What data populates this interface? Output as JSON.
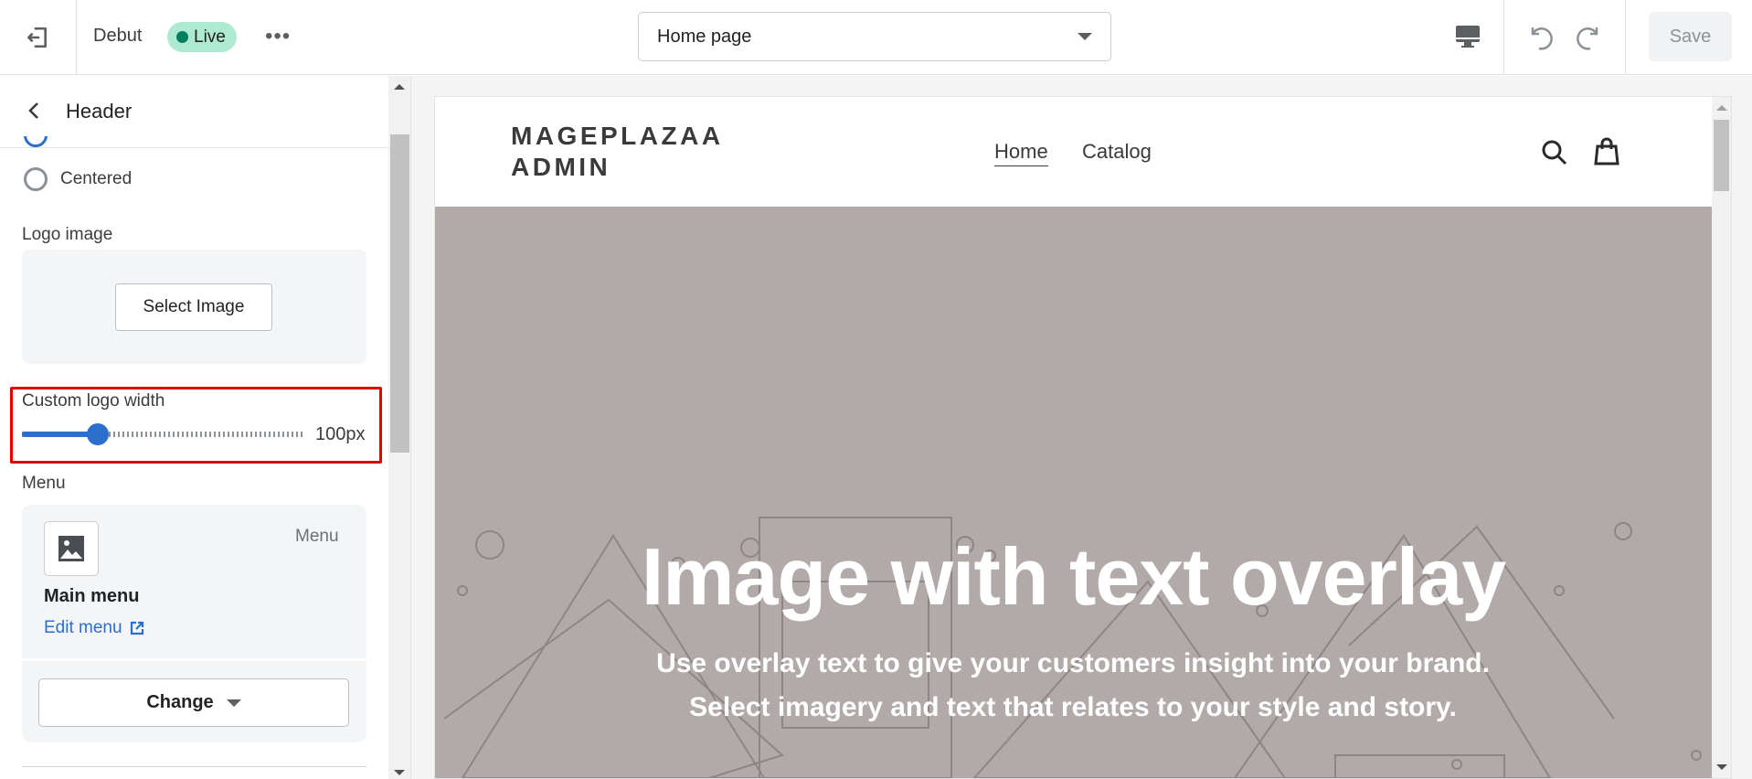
{
  "topbar": {
    "theme_name": "Debut",
    "status_badge": "Live",
    "more_label": "•••",
    "page_select": "Home page",
    "save_label": "Save"
  },
  "sidebar": {
    "title": "Header",
    "radio_option_centered": "Centered",
    "logo_image_label": "Logo image",
    "select_image_label": "Select Image",
    "custom_logo_width_label": "Custom logo width",
    "custom_logo_width_value": "100px",
    "custom_logo_width_fill_percent": 27,
    "menu_label": "Menu",
    "menu_card": {
      "type_label": "Menu",
      "name": "Main menu",
      "edit_link": "Edit menu",
      "change_label": "Change"
    }
  },
  "preview": {
    "store_logo_line1": "MAGEPLAZAA",
    "store_logo_line2": "ADMIN",
    "nav": [
      "Home",
      "Catalog"
    ],
    "hero_title": "Image with text overlay",
    "hero_subtitle": "Use overlay text to give your customers insight into your brand. Select imagery and text that relates to your style and story."
  },
  "colors": {
    "accent": "#2c6ecb",
    "live_badge": "#aee9d1",
    "highlight_box": "#e00000",
    "hero_bg": "#b2a9a9"
  }
}
